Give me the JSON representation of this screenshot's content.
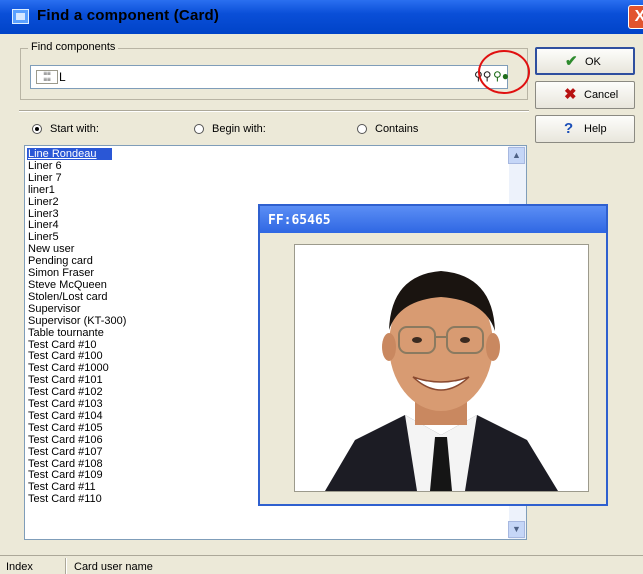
{
  "window": {
    "title": "Find a component (Card)",
    "close_label": "X"
  },
  "find_group": {
    "legend": "Find components",
    "search_value": "L"
  },
  "buttons": {
    "ok_label": "OK",
    "ok_icon": "checkmark-icon",
    "cancel_label": "Cancel",
    "cancel_icon": "x-icon",
    "help_label": "Help",
    "help_icon": "question-icon"
  },
  "search_options": [
    {
      "label": "Start with:",
      "selected": true
    },
    {
      "label": "Begin with:",
      "selected": false
    },
    {
      "label": "Contains",
      "selected": false
    }
  ],
  "list": {
    "selected_index": 0,
    "items": [
      "Line Rondeau",
      "Liner 6",
      "Liner 7",
      "liner1",
      "Liner2",
      "Liner3",
      "Liner4",
      "Liner5",
      "New user",
      "Pending card",
      "Simon Fraser",
      "Steve McQueen",
      "Stolen/Lost card",
      "Supervisor",
      "Supervisor (KT-300)",
      "Table tournante",
      "Test Card #10",
      "Test Card #100",
      "Test Card #1000",
      "Test Card #101",
      "Test Card #102",
      "Test Card #103",
      "Test Card #104",
      "Test Card #105",
      "Test Card #106",
      "Test Card #107",
      "Test Card #108",
      "Test Card #109",
      "Test Card #11",
      "Test Card #110"
    ]
  },
  "status": {
    "col1": "Index",
    "col2": "Card user name"
  },
  "popup": {
    "title": "FF:65465",
    "image": "portrait-photo"
  },
  "colors": {
    "titlebar": "#0a4fd8",
    "selection": "#2a57d6",
    "highlight_circle": "#e01010"
  }
}
